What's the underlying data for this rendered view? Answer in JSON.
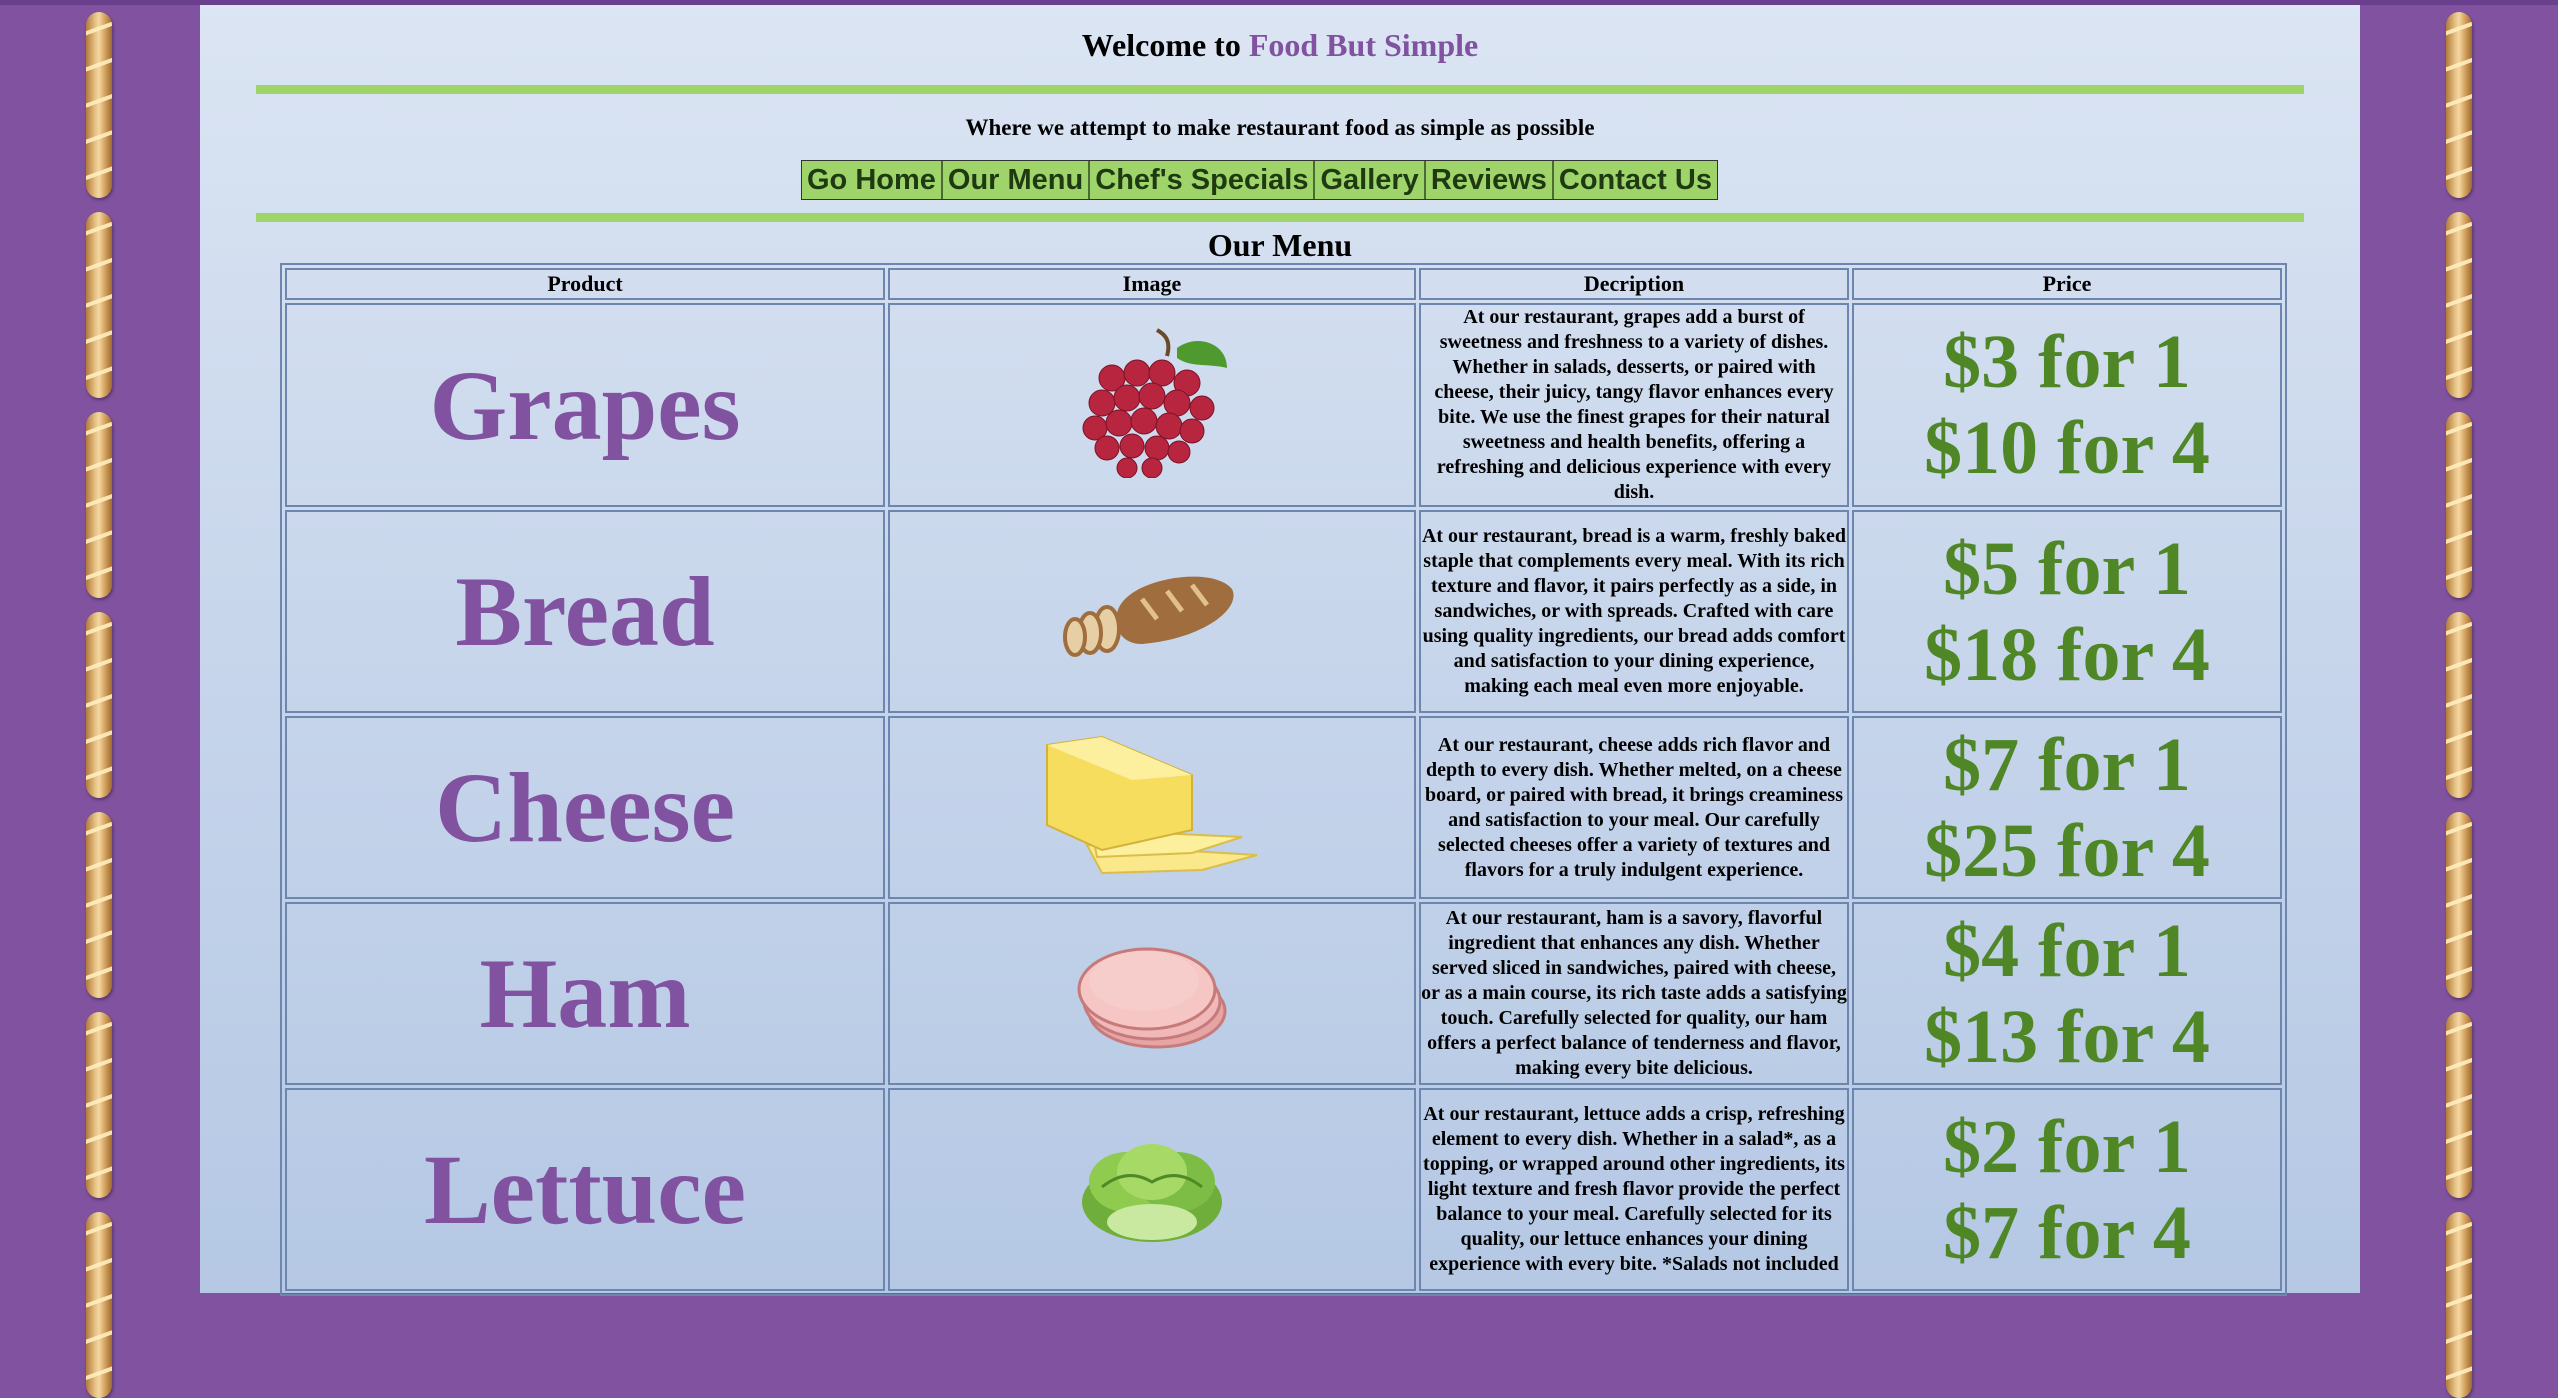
{
  "header": {
    "welcome_prefix": "Welcome to",
    "brand": "Food But Simple",
    "tagline": "Where we attempt to make restaurant food as simple as possible"
  },
  "nav": {
    "items": [
      {
        "label": "Go Home"
      },
      {
        "label": "Our Menu"
      },
      {
        "label": "Chef's Specials"
      },
      {
        "label": "Gallery"
      },
      {
        "label": "Reviews"
      },
      {
        "label": "Contact Us"
      }
    ]
  },
  "menu": {
    "title": "Our Menu",
    "columns": {
      "product": "Product",
      "image": "Image",
      "description": "Decription",
      "price": "Price"
    },
    "rows": [
      {
        "product": "Grapes",
        "image_icon": "grapes-icon",
        "description": "At our restaurant, grapes add a burst of sweetness and freshness to a variety of dishes. Whether in salads, desserts, or paired with cheese, their juicy, tangy flavor enhances every bite. We use the finest grapes for their natural sweetness and health benefits, offering a refreshing and delicious experience with every dish.",
        "price_single": "$3 for 1",
        "price_bulk": "$10 for 4"
      },
      {
        "product": "Bread",
        "image_icon": "bread-icon",
        "description": "At our restaurant, bread is a warm, freshly baked staple that complements every meal. With its rich texture and flavor, it pairs perfectly as a side, in sandwiches, or with spreads. Crafted with care using quality ingredients, our bread adds comfort and satisfaction to your dining experience, making each meal even more enjoyable.",
        "price_single": "$5 for 1",
        "price_bulk": "$18 for 4"
      },
      {
        "product": "Cheese",
        "image_icon": "cheese-icon",
        "description": "At our restaurant, cheese adds rich flavor and depth to every dish. Whether melted, on a cheese board, or paired with bread, it brings creaminess and satisfaction to your meal. Our carefully selected cheeses offer a variety of textures and flavors for a truly indulgent experience.",
        "price_single": "$7 for 1",
        "price_bulk": "$25 for 4"
      },
      {
        "product": "Ham",
        "image_icon": "ham-icon",
        "description": "At our restaurant, ham is a savory, flavorful ingredient that enhances any dish. Whether served sliced in sandwiches, paired with cheese, or as a main course, its rich taste adds a satisfying touch. Carefully selected for quality, our ham offers a perfect balance of tenderness and flavor, making every bite delicious.",
        "price_single": "$4 for 1",
        "price_bulk": "$13 for 4"
      },
      {
        "product": "Lettuce",
        "image_icon": "lettuce-icon",
        "description": "At our restaurant, lettuce adds a crisp, refreshing element to every dish. Whether in a salad*, as a topping, or wrapped around other ingredients, its light texture and fresh flavor provide the perfect balance to your meal. Carefully selected for its quality, our lettuce enhances your dining experience with every bite. *Salads not included",
        "price_single": "$2 for 1",
        "price_bulk": "$7 for 4"
      }
    ]
  },
  "colors": {
    "background": "#8152a0",
    "brand": "#8152a0",
    "accent_bar": "#9ed46a",
    "price": "#4f8726"
  }
}
